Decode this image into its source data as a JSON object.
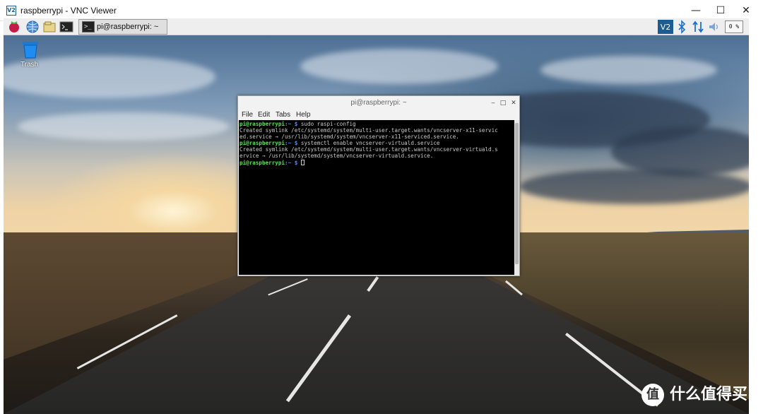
{
  "window": {
    "title": "raspberrypi - VNC Viewer",
    "logo_text": "V2",
    "controls": {
      "minimize": "—",
      "maximize": "☐",
      "close": "✕"
    }
  },
  "panel": {
    "task_button_label": "pi@raspberrypi: ~",
    "task_button_icon": ">_",
    "cpu_label": "0 %",
    "icons": [
      "raspberry-menu-icon",
      "web-browser-icon",
      "file-manager-icon",
      "terminal-icon",
      "vnc-icon",
      "bluetooth-icon",
      "network-icon",
      "volume-icon"
    ],
    "accent_color": "#1c5c91"
  },
  "desktop": {
    "trash_label": "Trash"
  },
  "terminal": {
    "title": "pi@raspberrypi: ~",
    "controls": {
      "minimize": "‒",
      "maximize": "□",
      "close": "✕"
    },
    "menu": [
      "File",
      "Edit",
      "Tabs",
      "Help"
    ],
    "prompt_user": "pi@raspberrypi",
    "prompt_path": ":~ $",
    "lines": [
      {
        "type": "prompt",
        "command": " sudo raspi-config"
      },
      {
        "type": "output",
        "text": "Created symlink /etc/systemd/system/multi-user.target.wants/vncserver-x11-servic"
      },
      {
        "type": "output",
        "text": "ed.service → /usr/lib/systemd/system/vncserver-x11-serviced.service."
      },
      {
        "type": "prompt",
        "command": " systemctl enable vncserver-virtuald.service"
      },
      {
        "type": "output",
        "text": "Created symlink /etc/systemd/system/multi-user.target.wants/vncserver-virtuald.s"
      },
      {
        "type": "output",
        "text": "ervice → /usr/lib/systemd/system/vncserver-virtuald.service."
      },
      {
        "type": "prompt",
        "command": " "
      }
    ]
  },
  "watermark": {
    "icon": "值",
    "text": "什么值得买"
  }
}
